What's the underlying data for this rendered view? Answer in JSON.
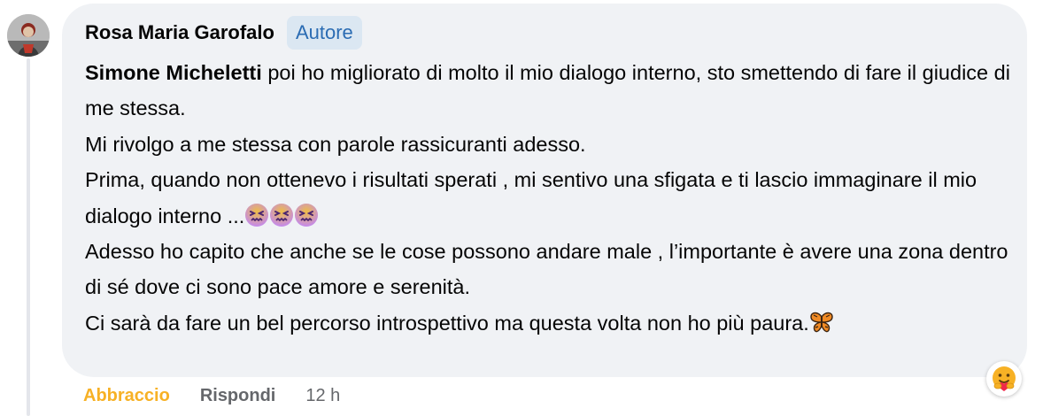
{
  "comment": {
    "author_name": "Rosa Maria Garofalo",
    "author_badge": "Autore",
    "mention": "Simone Micheletti",
    "line1_rest": " poi ho migliorato di molto il mio dialogo interno, sto smettendo di fare il giudice di me stessa.",
    "line2": "Mi rivolgo a me stessa con parole rassicuranti adesso.",
    "line3_text": "Prima, quando non ottenevo i risultati sperati , mi sentivo una sfigata e ti lascio immaginare il mio dialogo interno ...",
    "line3_emojis": [
      "confounded-face",
      "confounded-face",
      "confounded-face"
    ],
    "line4": "Adesso ho capito che anche se le cose possono andare male , l’importante è avere una zona dentro di sé dove ci sono pace amore e serenità.",
    "line5_text": "Ci sarà da fare un bel percorso introspettivo ma questa volta non ho più paura.",
    "line5_emoji": "butterfly"
  },
  "actions": {
    "reaction_label": "Abbraccio",
    "reply_label": "Rispondi",
    "timestamp": "12 h"
  },
  "reaction_badge": {
    "icon": "care-hug-emoji-icon"
  },
  "colors": {
    "bubble": "#f0f2f5",
    "badge_bg": "#dbe7f2",
    "badge_text": "#2b6cb3",
    "hug_label": "#f7b125",
    "secondary_text": "#65676b"
  }
}
